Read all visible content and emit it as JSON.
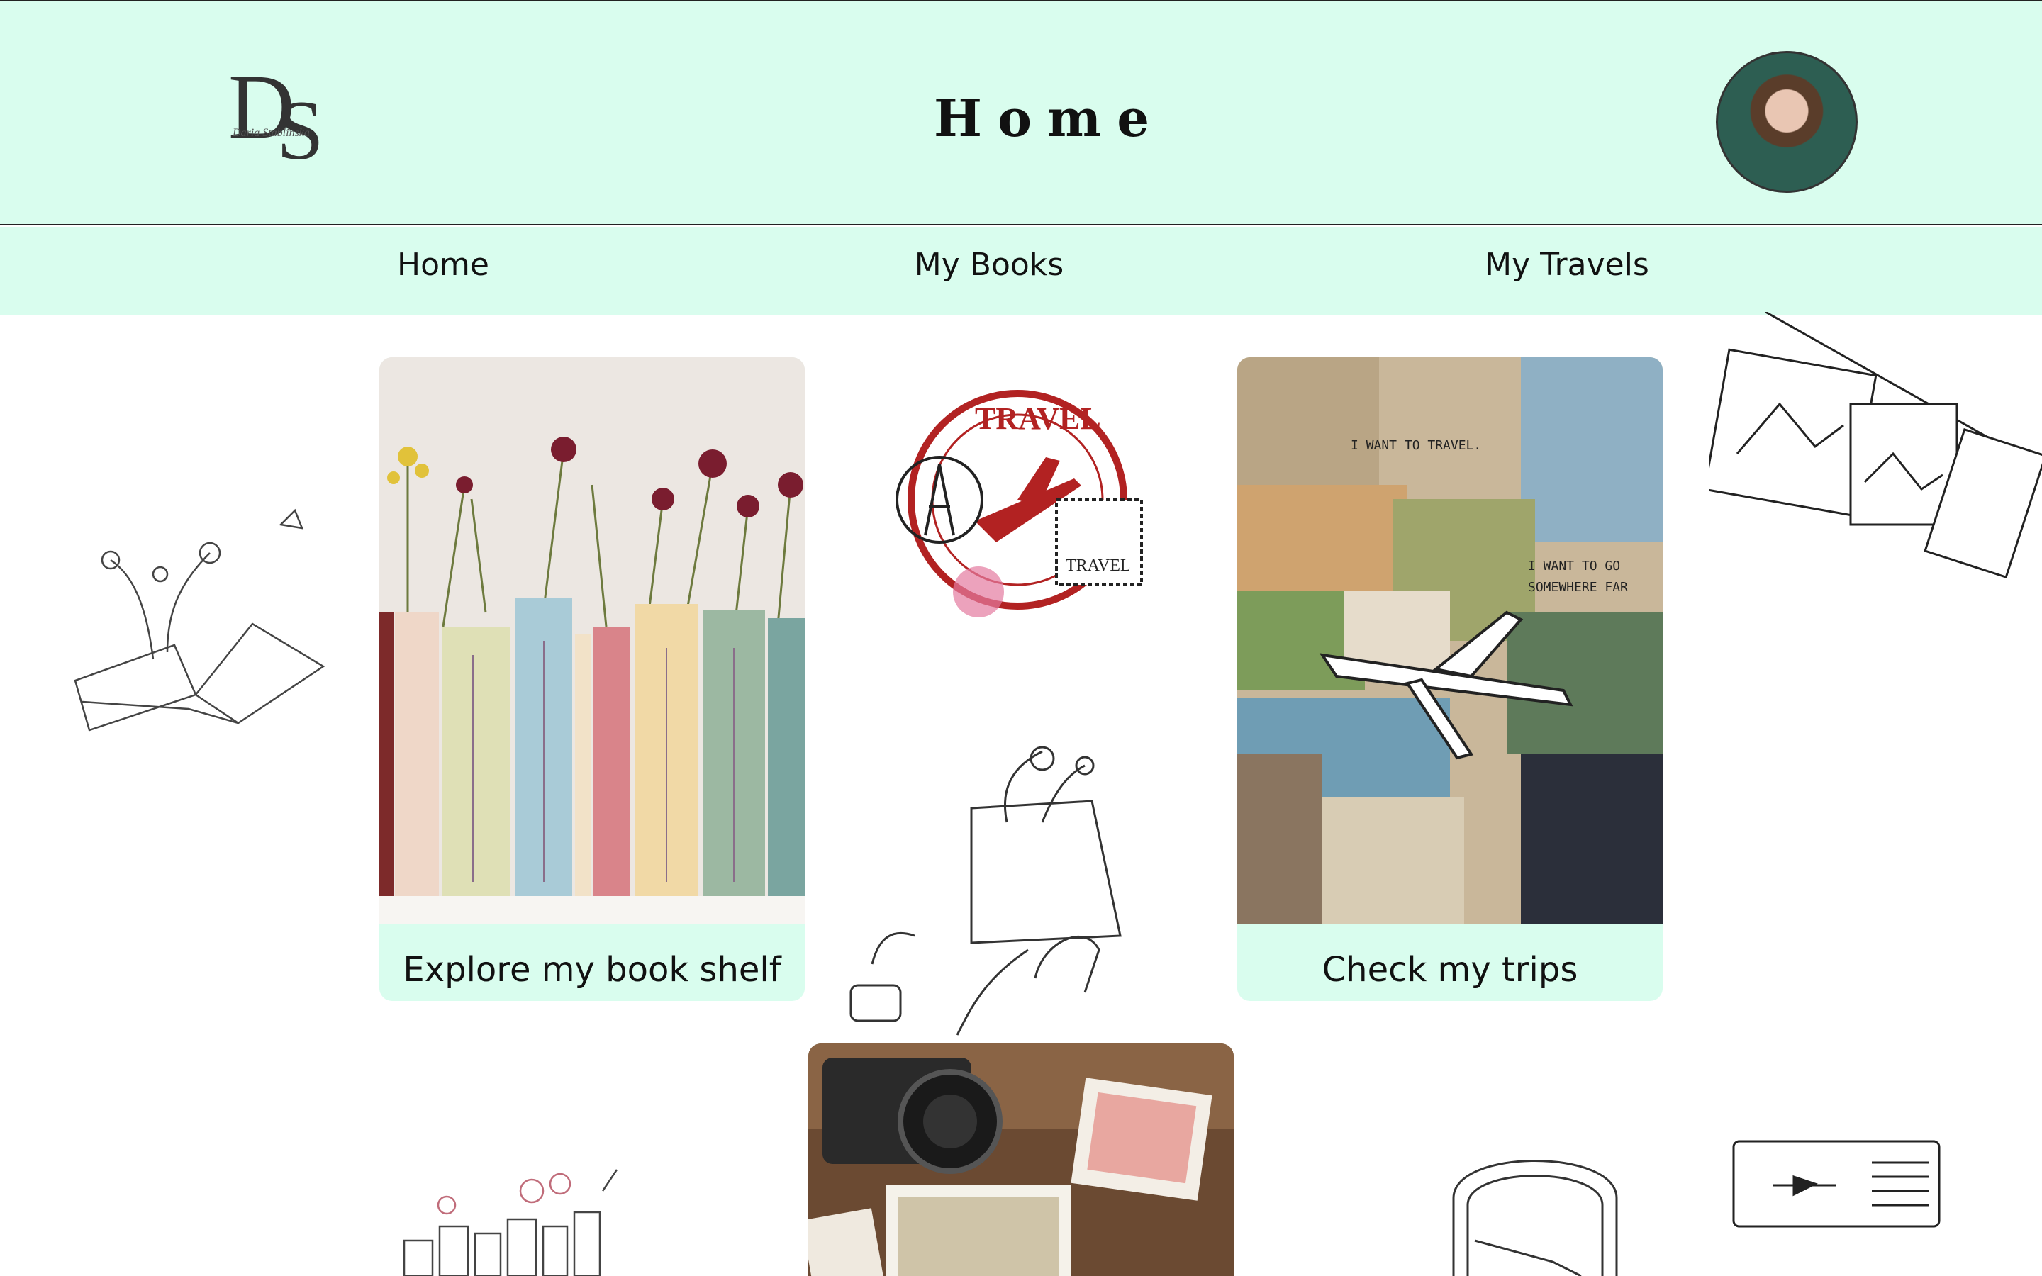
{
  "header": {
    "logo_text": "DS",
    "logo_sub": "Daria Stablinska",
    "title": "Home"
  },
  "nav": {
    "items": [
      {
        "label": "Home"
      },
      {
        "label": "My Books"
      },
      {
        "label": "My Travels"
      }
    ]
  },
  "cards": {
    "books": {
      "label": "Explore my book shelf"
    },
    "trips": {
      "label": "Check my trips"
    }
  },
  "stamps": {
    "travel_stamp": "TRAVEL",
    "postage_stamp": "TRAVEL"
  },
  "colors": {
    "header_bg": "#d9fdee",
    "card_bg": "#d9fdee",
    "stamp_red": "#b22222"
  }
}
